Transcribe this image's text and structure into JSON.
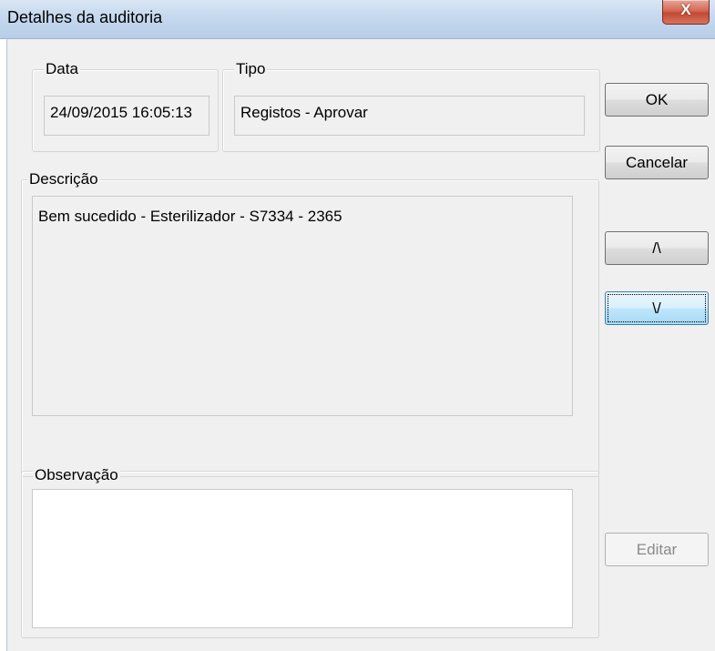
{
  "window": {
    "title": "Detalhes da auditoria",
    "close_label": "X"
  },
  "data_group": {
    "label": "Data",
    "value": "24/09/2015 16:05:13"
  },
  "tipo_group": {
    "label": "Tipo",
    "value": "Registos - Aprovar"
  },
  "descricao_group": {
    "label": "Descrição",
    "value": "Bem sucedido - Esterilizador - S7334 - 2365"
  },
  "observacao_group": {
    "label": "Observação",
    "value": ""
  },
  "buttons": {
    "ok": "OK",
    "cancel": "Cancelar",
    "up": "/\\",
    "down": "\\/",
    "edit": "Editar"
  }
}
